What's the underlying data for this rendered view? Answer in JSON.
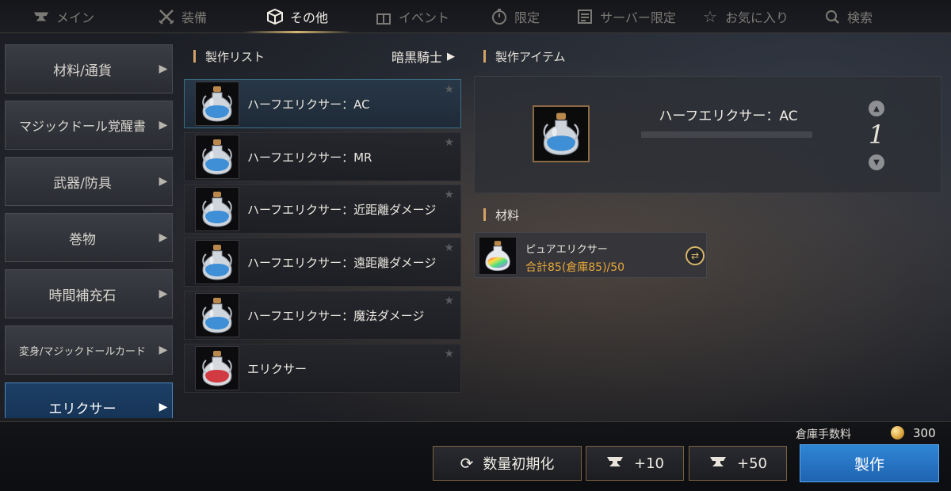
{
  "tabs": [
    {
      "label": "メイン",
      "icon": "anvil-icon",
      "active": false
    },
    {
      "label": "装備",
      "icon": "crossed-swords-icon",
      "active": false
    },
    {
      "label": "その他",
      "icon": "box-icon",
      "active": true
    },
    {
      "label": "イベント",
      "icon": "gift-icon",
      "active": false
    },
    {
      "label": "限定",
      "icon": "stopwatch-icon",
      "active": false
    },
    {
      "label": "サーバー限定",
      "icon": "server-list-icon",
      "active": false
    },
    {
      "label": "お気に入り",
      "icon": "star-outline-icon",
      "active": false
    },
    {
      "label": "検索",
      "icon": "search-icon",
      "active": false
    }
  ],
  "categories": [
    {
      "label": "材料/通貨",
      "active": false
    },
    {
      "label": "マジックドール覚醒書",
      "active": false
    },
    {
      "label": "武器/防具",
      "active": false
    },
    {
      "label": "巻物",
      "active": false
    },
    {
      "label": "時間補充石",
      "active": false
    },
    {
      "label": "変身/マジックドールカード",
      "active": false
    },
    {
      "label": "エリクサー",
      "active": true
    }
  ],
  "craft_list": {
    "header": "製作リスト",
    "filter_label": "暗黒騎士",
    "items": [
      {
        "name": "ハーフエリクサー：AC",
        "potion": "blue",
        "selected": true
      },
      {
        "name": "ハーフエリクサー：MR",
        "potion": "blue",
        "selected": false
      },
      {
        "name": "ハーフエリクサー：近距離ダメージ",
        "potion": "blue",
        "selected": false
      },
      {
        "name": "ハーフエリクサー：遠距離ダメージ",
        "potion": "blue",
        "selected": false
      },
      {
        "name": "ハーフエリクサー：魔法ダメージ",
        "potion": "blue",
        "selected": false
      },
      {
        "name": "エリクサー",
        "potion": "red",
        "selected": false
      }
    ]
  },
  "craft_item": {
    "header": "製作アイテム",
    "name": "ハーフエリクサー：AC",
    "quantity": "1"
  },
  "materials": {
    "header": "材料",
    "items": [
      {
        "name": "ピュアエリクサー",
        "count": "合計85(倉庫85)/50"
      }
    ]
  },
  "footer": {
    "fee_label": "倉庫手数料",
    "fee_value": "300",
    "reset_label": "数量初期化",
    "plus10_label": "+10",
    "plus50_label": "+50",
    "craft_label": "製作"
  },
  "colors": {
    "accent_gold": "#d4a264",
    "craft_button": "#2f86d6",
    "material_count": "#e7a73a",
    "selected_category": "#1d3f66"
  }
}
